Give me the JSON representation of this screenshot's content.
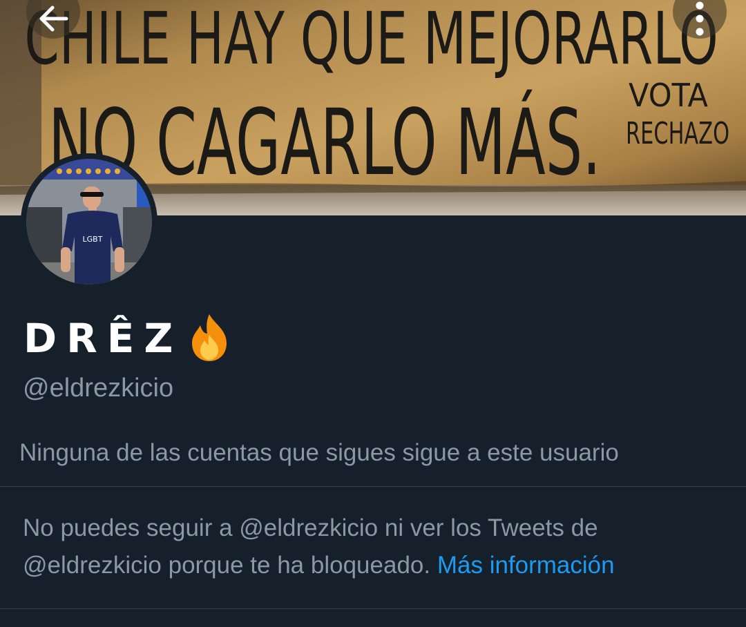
{
  "banner": {
    "line1": "CHILE HAY QUE MEJORARLO",
    "line2": "NO CAGARLO MÁS.",
    "stamp_line1": "VOTA",
    "stamp_line2": "RECHAZO",
    "colors": {
      "wood": "#b08a4e",
      "wood_dark": "#6e5430",
      "ink": "#1c1a16"
    }
  },
  "header": {
    "back_icon": "arrow-left-icon",
    "more_icon": "more-vertical-icon"
  },
  "profile": {
    "display_name": "DRÊZ",
    "name_emoji": "fire-icon",
    "handle": "@eldrezkicio",
    "followers_you_know": "Ninguna de las cuentas que sigues sigue a este usuario",
    "shirt_text": "LGBT"
  },
  "blocked": {
    "message": "No puedes seguir a @eldrezkicio ni ver los Tweets de @eldrezkicio porque te ha bloqueado.",
    "link_label": "Más información"
  },
  "colors": {
    "background": "#15202b",
    "primary_text": "#ffffff",
    "secondary_text": "#8b98a5",
    "link": "#1d9bf0",
    "divider": "#38444d"
  }
}
